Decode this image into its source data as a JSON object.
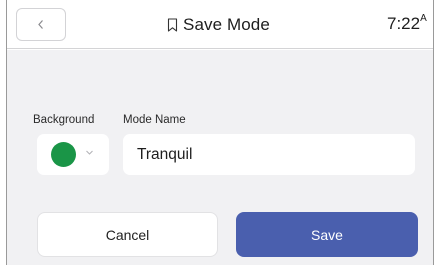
{
  "header": {
    "back_icon": "chevron-left-icon",
    "title_icon": "bookmark-icon",
    "title": "Save Mode",
    "clock_time": "7:22",
    "clock_suffix": "A"
  },
  "form": {
    "background_label": "Background",
    "background_color": "#1a9547",
    "background_chevron_icon": "chevron-down-icon",
    "mode_name_label": "Mode Name",
    "mode_name_value": "Tranquil"
  },
  "actions": {
    "cancel_label": "Cancel",
    "save_label": "Save"
  },
  "colors": {
    "accent": "#4a5fae",
    "panel_background": "#f1f1f3",
    "swatch": "#1a9547"
  }
}
